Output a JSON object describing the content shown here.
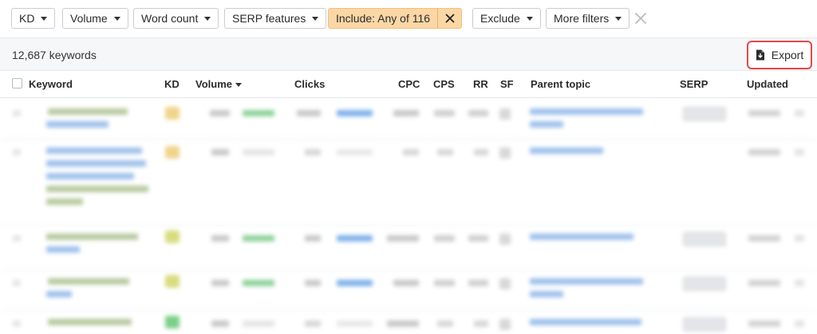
{
  "filters": {
    "kd": "KD",
    "volume": "Volume",
    "word_count": "Word count",
    "serp_features": "SERP features",
    "include": "Include: Any of 116",
    "exclude": "Exclude",
    "more_filters": "More filters"
  },
  "summary": {
    "keyword_count": "12,687 keywords",
    "export_label": "Export"
  },
  "columns": {
    "keyword": "Keyword",
    "kd": "KD",
    "volume": "Volume",
    "clicks": "Clicks",
    "cpc": "CPC",
    "cps": "CPS",
    "rr": "RR",
    "sf": "SF",
    "parent_topic": "Parent topic",
    "serp": "SERP",
    "updated": "Updated"
  },
  "colors": {
    "include_active_bg": "#fbd7a6",
    "export_highlight": "#e5474b",
    "link_blue": "#3c7be0",
    "kd_yellow": "#f1cf55",
    "kd_green": "#4fb86a",
    "keyword_highlight": "#c9d86b"
  },
  "icons": {
    "export": "file-download-icon",
    "clear": "close-icon",
    "include_remove": "close-icon",
    "dropdown": "chevron-down-icon"
  }
}
